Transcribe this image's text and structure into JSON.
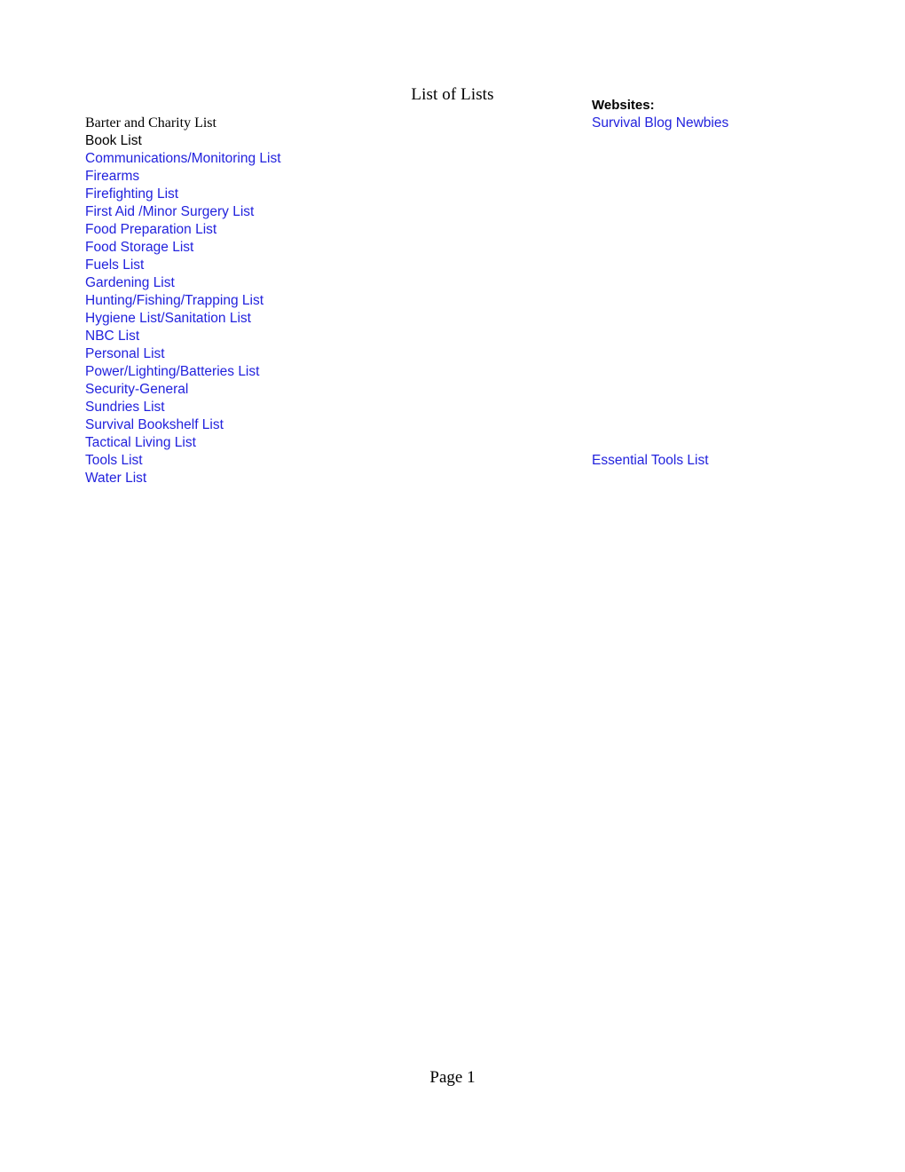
{
  "document": {
    "title": "List of Lists",
    "footer": "Page 1",
    "link_color": "#2222DD",
    "text_color": "#000000",
    "background_color": "#FFFFFF"
  },
  "left_column": {
    "items": [
      {
        "label": "Barter and Charity List",
        "style": "serif-black"
      },
      {
        "label": "Book List",
        "style": "sans-black"
      },
      {
        "label": "Communications/Monitoring List",
        "style": "link"
      },
      {
        "label": "Firearms",
        "style": "link"
      },
      {
        "label": "Firefighting List",
        "style": "link"
      },
      {
        "label": "First Aid /Minor Surgery List",
        "style": "link"
      },
      {
        "label": "Food Preparation List",
        "style": "link"
      },
      {
        "label": "Food Storage List",
        "style": "link"
      },
      {
        "label": "Fuels List",
        "style": "link"
      },
      {
        "label": "Gardening List",
        "style": "link"
      },
      {
        "label": "Hunting/Fishing/Trapping List",
        "style": "link"
      },
      {
        "label": "Hygiene List/Sanitation List",
        "style": "link"
      },
      {
        "label": "NBC List",
        "style": "link"
      },
      {
        "label": "Personal List",
        "style": "link"
      },
      {
        "label": "Power/Lighting/Batteries List",
        "style": "link"
      },
      {
        "label": "Security-General",
        "style": "link"
      },
      {
        "label": "Sundries List",
        "style": "link"
      },
      {
        "label": "Survival Bookshelf List",
        "style": "link"
      },
      {
        "label": "Tactical Living List",
        "style": "link"
      },
      {
        "label": "Tools List",
        "style": "link"
      },
      {
        "label": "Water List",
        "style": "link"
      }
    ]
  },
  "right_column": {
    "heading": "Websites:",
    "items": [
      {
        "label": "Survival Blog Newbies",
        "style": "link"
      },
      {
        "label": "Essential Tools List",
        "style": "link"
      }
    ]
  },
  "layout": {
    "right_heading_row": -1,
    "right_item_rows": [
      0,
      19
    ]
  }
}
